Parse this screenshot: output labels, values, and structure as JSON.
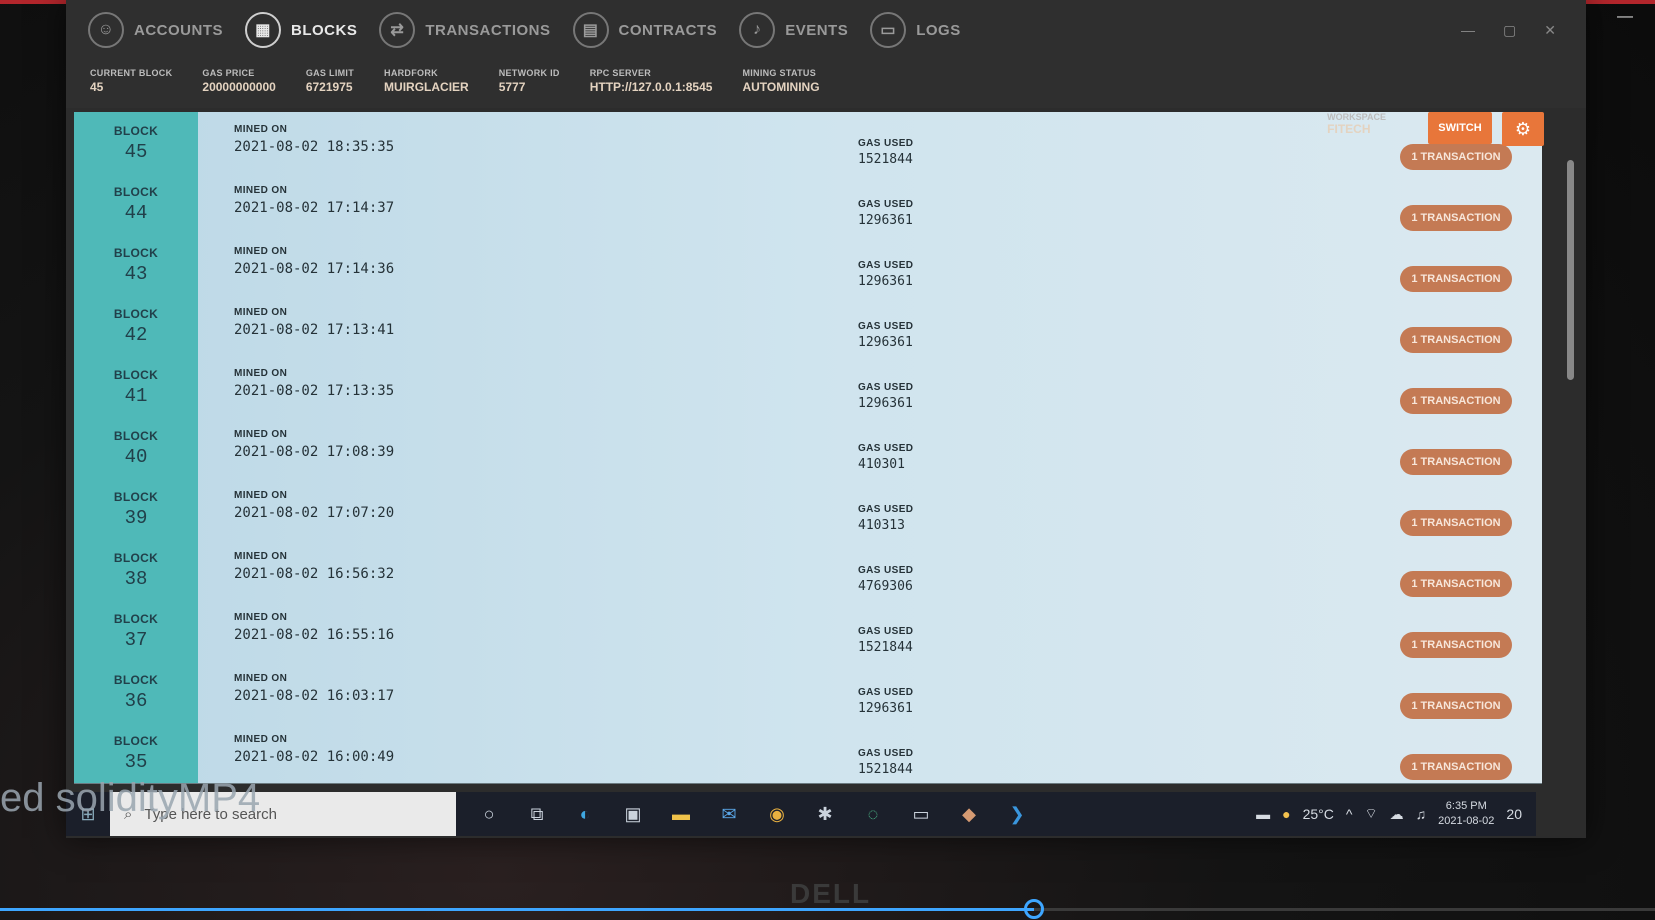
{
  "nav": [
    {
      "label": "ACCOUNTS",
      "icon": "account-icon",
      "glyph": "☺",
      "active": false
    },
    {
      "label": "BLOCKS",
      "icon": "blocks-icon",
      "glyph": "▦",
      "active": true
    },
    {
      "label": "TRANSACTIONS",
      "icon": "transactions-icon",
      "glyph": "⇄",
      "active": false
    },
    {
      "label": "CONTRACTS",
      "icon": "contracts-icon",
      "glyph": "▤",
      "active": false
    },
    {
      "label": "EVENTS",
      "icon": "bell-icon",
      "glyph": "♪",
      "active": false
    },
    {
      "label": "LOGS",
      "icon": "logs-icon",
      "glyph": "▭",
      "active": false
    }
  ],
  "stats": [
    {
      "key": "CURRENT BLOCK",
      "value": "45"
    },
    {
      "key": "GAS PRICE",
      "value": "20000000000"
    },
    {
      "key": "GAS LIMIT",
      "value": "6721975"
    },
    {
      "key": "HARDFORK",
      "value": "MUIRGLACIER"
    },
    {
      "key": "NETWORK ID",
      "value": "5777"
    },
    {
      "key": "RPC SERVER",
      "value": "HTTP://127.0.0.1:8545"
    },
    {
      "key": "MINING STATUS",
      "value": "AUTOMINING"
    }
  ],
  "workspace": {
    "key": "WORKSPACE",
    "value": "FITECH"
  },
  "switch_label": "SWITCH",
  "labels": {
    "block": "BLOCK",
    "mined_on": "MINED ON",
    "gas_used": "GAS USED"
  },
  "blocks": [
    {
      "number": "45",
      "mined_on": "2021-08-02 18:35:35",
      "gas_used": "1521844",
      "tx": "1 TRANSACTION"
    },
    {
      "number": "44",
      "mined_on": "2021-08-02 17:14:37",
      "gas_used": "1296361",
      "tx": "1 TRANSACTION"
    },
    {
      "number": "43",
      "mined_on": "2021-08-02 17:14:36",
      "gas_used": "1296361",
      "tx": "1 TRANSACTION"
    },
    {
      "number": "42",
      "mined_on": "2021-08-02 17:13:41",
      "gas_used": "1296361",
      "tx": "1 TRANSACTION"
    },
    {
      "number": "41",
      "mined_on": "2021-08-02 17:13:35",
      "gas_used": "1296361",
      "tx": "1 TRANSACTION"
    },
    {
      "number": "40",
      "mined_on": "2021-08-02 17:08:39",
      "gas_used": "410301",
      "tx": "1 TRANSACTION"
    },
    {
      "number": "39",
      "mined_on": "2021-08-02 17:07:20",
      "gas_used": "410313",
      "tx": "1 TRANSACTION"
    },
    {
      "number": "38",
      "mined_on": "2021-08-02 16:56:32",
      "gas_used": "4769306",
      "tx": "1 TRANSACTION"
    },
    {
      "number": "37",
      "mined_on": "2021-08-02 16:55:16",
      "gas_used": "1521844",
      "tx": "1 TRANSACTION"
    },
    {
      "number": "36",
      "mined_on": "2021-08-02 16:03:17",
      "gas_used": "1296361",
      "tx": "1 TRANSACTION"
    },
    {
      "number": "35",
      "mined_on": "2021-08-02 16:00:49",
      "gas_used": "1521844",
      "tx": "1 TRANSACTION"
    }
  ],
  "taskbar": {
    "search_placeholder": "Type here to search",
    "weather": "25°C",
    "time": "6:35 PM",
    "date": "2021-08-02",
    "notifications": "20"
  },
  "caption": "ed solidityMP4",
  "brand": "DELL",
  "video_progress": 0.625
}
